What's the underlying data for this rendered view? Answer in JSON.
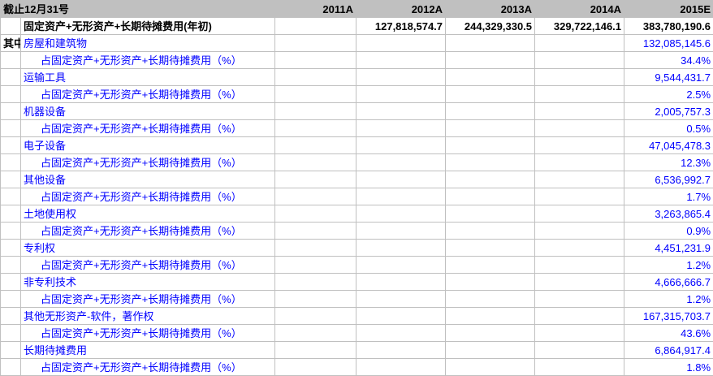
{
  "header": {
    "title": "截止12月31号",
    "years": [
      "2011A",
      "2012A",
      "2013A",
      "2014A",
      "2015E"
    ]
  },
  "total_row": {
    "label": "固定资产+无形资产+长期待摊费用(年初)",
    "values": [
      "",
      "127,818,574.7",
      "244,329,330.5",
      "329,722,146.1",
      "383,780,190.6"
    ]
  },
  "prefix_label": "其中：",
  "rows": [
    {
      "label": "房屋和建筑物",
      "value": "132,085,145.6"
    },
    {
      "label": "占固定资产+无形资产+长期待摊费用（%）",
      "value": "34.4%"
    },
    {
      "label": "运输工具",
      "value": "9,544,431.7"
    },
    {
      "label": "占固定资产+无形资产+长期待摊费用（%）",
      "value": "2.5%"
    },
    {
      "label": "机器设备",
      "value": "2,005,757.3"
    },
    {
      "label": "占固定资产+无形资产+长期待摊费用（%）",
      "value": "0.5%"
    },
    {
      "label": "电子设备",
      "value": "47,045,478.3"
    },
    {
      "label": "占固定资产+无形资产+长期待摊费用（%）",
      "value": "12.3%"
    },
    {
      "label": "其他设备",
      "value": "6,536,992.7"
    },
    {
      "label": "占固定资产+无形资产+长期待摊费用（%）",
      "value": "1.7%"
    },
    {
      "label": "土地使用权",
      "value": "3,263,865.4"
    },
    {
      "label": "占固定资产+无形资产+长期待摊费用（%）",
      "value": "0.9%"
    },
    {
      "label": "专利权",
      "value": "4,451,231.9"
    },
    {
      "label": "占固定资产+无形资产+长期待摊费用（%）",
      "value": "1.2%"
    },
    {
      "label": "非专利技术",
      "value": "4,666,666.7"
    },
    {
      "label": "占固定资产+无形资产+长期待摊费用（%）",
      "value": "1.2%"
    },
    {
      "label": "其他无形资产-软件，著作权",
      "value": "167,315,703.7"
    },
    {
      "label": "占固定资产+无形资产+长期待摊费用（%）",
      "value": "43.6%"
    },
    {
      "label": "长期待摊费用",
      "value": "6,864,917.4"
    },
    {
      "label": "占固定资产+无形资产+长期待摊费用（%）",
      "value": "1.8%"
    }
  ]
}
